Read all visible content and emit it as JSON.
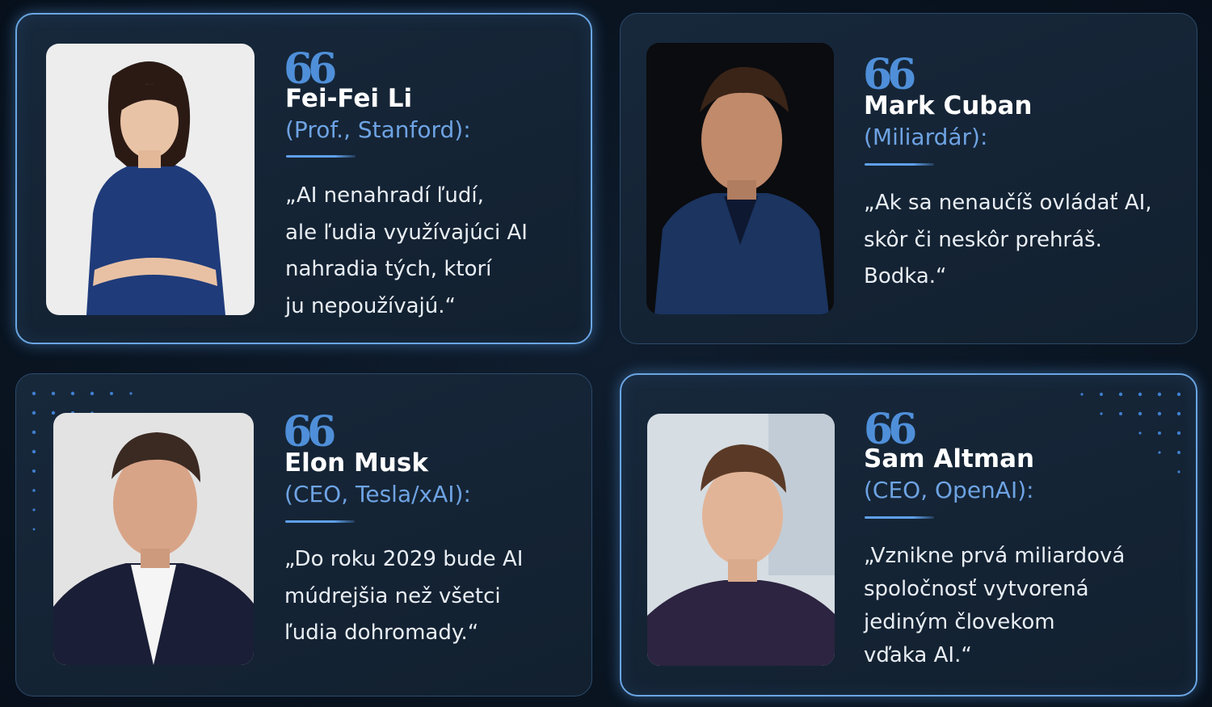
{
  "cards": [
    {
      "name": "Fei-Fei Li",
      "role": "(Prof., Stanford):",
      "quote_lines": [
        "„AI nenahradí ľudí,",
        "ale ľudia využívajúci AI",
        "nahradia tých, ktorí",
        "ju nepoužívajú.“"
      ],
      "photo": "portrait-photo"
    },
    {
      "name": "Mark Cuban",
      "role": "(Miliardár):",
      "quote_lines": [
        "„Ak sa nenaučíš ovládať AI,",
        "skôr či neskôr prehráš.",
        "Bodka.“"
      ],
      "photo": "portrait-photo"
    },
    {
      "name": "Elon Musk",
      "role": "(CEO, Tesla/xAI):",
      "quote_lines": [
        "„Do roku 2029 bude AI",
        "múdrejšia než všetci",
        "ľudia dohromady.“"
      ],
      "photo": "portrait-photo"
    },
    {
      "name": "Sam Altman",
      "role": "(CEO, OpenAI):",
      "quote_lines": [
        "„Vznikne prvá miliardová",
        "spoločnosť vytvorená",
        "jediným človekom",
        "vďaka AI.“"
      ],
      "photo": "portrait-photo"
    }
  ],
  "quote_mark": "66",
  "colors": {
    "accent": "#6ea3e3",
    "quote_mark": "#4f8fd9",
    "card_border_glow": "#6aa6e4",
    "background": "#0a1522"
  },
  "icons": {
    "quote": "quote-mark-icon"
  }
}
